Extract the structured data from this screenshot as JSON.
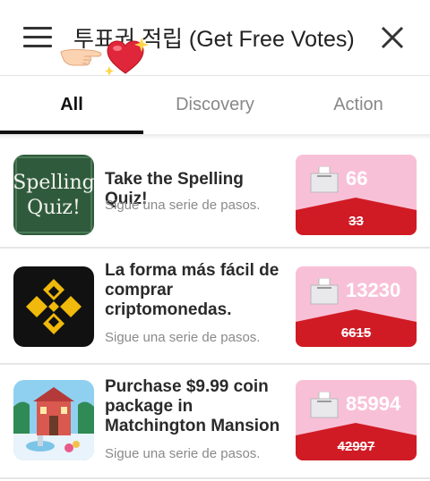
{
  "header": {
    "title": "투표권 적립 (Get Free Votes)",
    "menu_icon": "hamburger-menu-icon",
    "close_icon": "close-icon"
  },
  "tabs": [
    {
      "label": "All",
      "active": true
    },
    {
      "label": "Discovery",
      "active": false
    },
    {
      "label": "Action",
      "active": false
    }
  ],
  "offers": [
    {
      "title": "Take the Spelling Quiz!",
      "subtitle": "Sigue una serie de pasos.",
      "reward": "66",
      "original_reward": "33",
      "thumb_text": [
        "Spelling",
        "Quiz!"
      ]
    },
    {
      "title": "La forma más fácil de comprar criptomonedas.",
      "subtitle": "Sigue una serie de pasos.",
      "reward": "13230",
      "original_reward": "6615"
    },
    {
      "title": "Purchase $9.99 coin package in Matchington Mansion",
      "subtitle": "Sigue una serie de pasos.",
      "reward": "85994",
      "original_reward": "42997"
    }
  ],
  "colors": {
    "reward_pink": "#f8c0d6",
    "reward_red": "#d01b25",
    "chalkboard_green": "#2f5b3c",
    "crypto_yellow": "#f0b90b"
  }
}
